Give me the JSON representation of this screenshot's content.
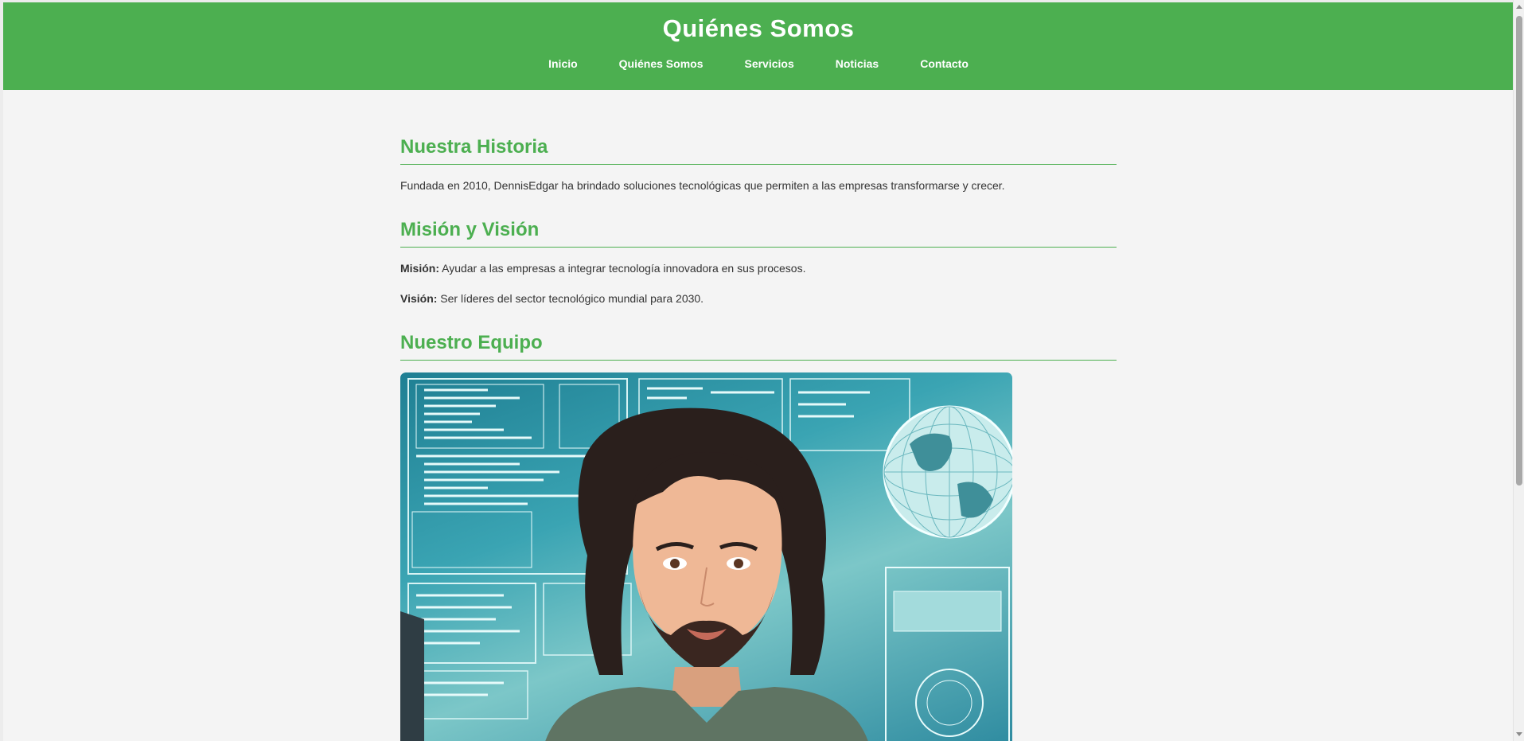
{
  "header": {
    "title": "Quiénes Somos",
    "nav": [
      {
        "label": "Inicio"
      },
      {
        "label": "Quiénes Somos"
      },
      {
        "label": "Servicios"
      },
      {
        "label": "Noticias"
      },
      {
        "label": "Contacto"
      }
    ]
  },
  "sections": {
    "history": {
      "heading": "Nuestra Historia",
      "text": "Fundada en 2010, DennisEdgar ha brindado soluciones tecnológicas que permiten a las empresas transformarse y crecer."
    },
    "mission_vision": {
      "heading": "Misión y Visión",
      "mission_label": "Misión:",
      "mission_text": " Ayudar a las empresas a integrar tecnología innovadora en sus procesos.",
      "vision_label": "Visión:",
      "vision_text": " Ser líderes del sector tecnológico mundial para 2030."
    },
    "team": {
      "heading": "Nuestro Equipo"
    }
  },
  "colors": {
    "accent": "#4CAF50",
    "page_background": "#f4f4f4",
    "text": "#333333"
  }
}
